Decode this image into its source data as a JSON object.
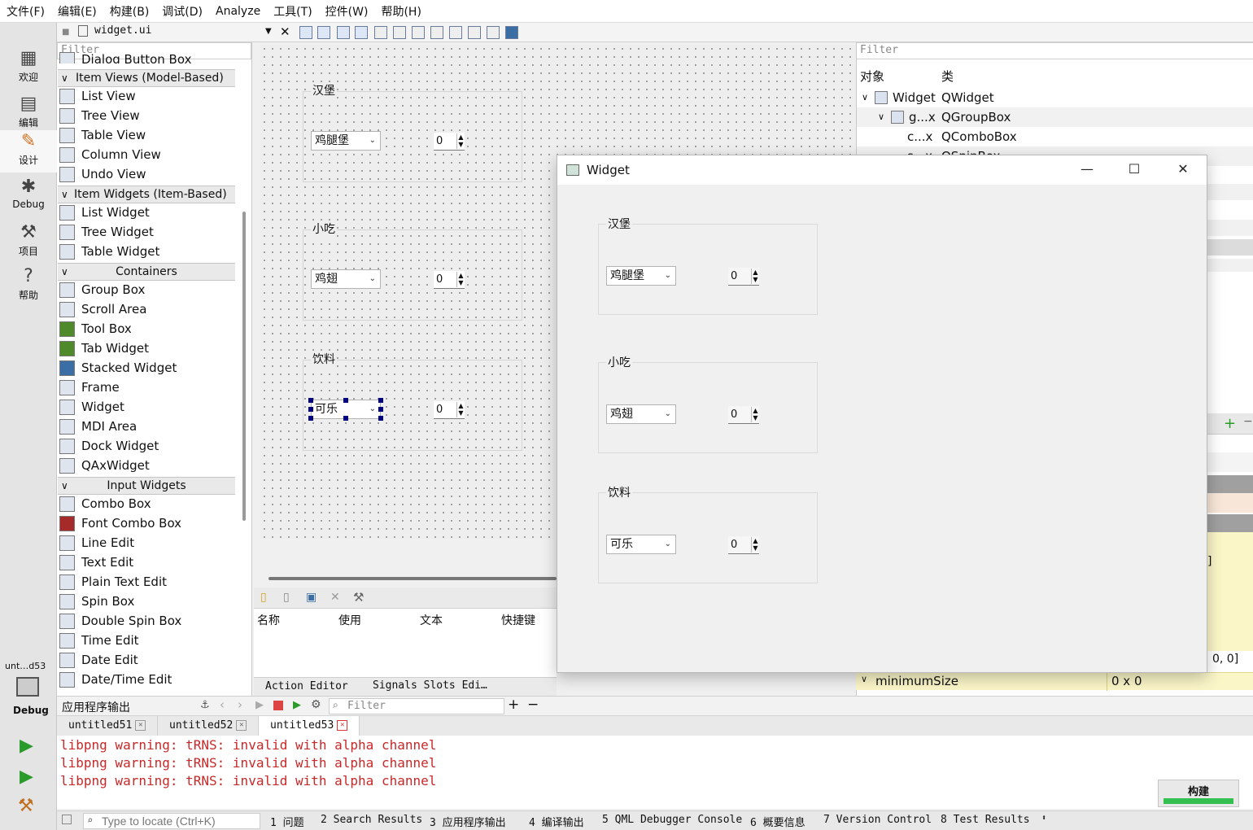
{
  "menu": [
    "文件(F)",
    "编辑(E)",
    "构建(B)",
    "调试(D)",
    "Analyze",
    "工具(T)",
    "控件(W)",
    "帮助(H)"
  ],
  "modes": [
    {
      "label": "欢迎",
      "icon": "grid-icon"
    },
    {
      "label": "编辑",
      "icon": "document-icon"
    },
    {
      "label": "设计",
      "icon": "pencil-icon"
    },
    {
      "label": "Debug",
      "icon": "bug-icon"
    },
    {
      "label": "项目",
      "icon": "wrench-icon"
    },
    {
      "label": "帮助",
      "icon": "help-icon"
    }
  ],
  "kit": {
    "label": "unt…d53",
    "mode": "Debug"
  },
  "editor": {
    "file": "widget.ui"
  },
  "widgetbox": {
    "filter": "Filter",
    "cut_item": "Dialog Button Box",
    "categories": [
      {
        "title": "Item Views (Model-Based)",
        "items": [
          "List View",
          "Tree View",
          "Table View",
          "Column View",
          "Undo View"
        ]
      },
      {
        "title": "Item Widgets (Item-Based)",
        "items": [
          "List Widget",
          "Tree Widget",
          "Table Widget"
        ]
      },
      {
        "title": "Containers",
        "items": [
          "Group Box",
          "Scroll Area",
          "Tool Box",
          "Tab Widget",
          "Stacked Widget",
          "Frame",
          "Widget",
          "MDI Area",
          "Dock Widget",
          "QAxWidget"
        ]
      },
      {
        "title": "Input Widgets",
        "items": [
          "Combo Box",
          "Font Combo Box",
          "Line Edit",
          "Text Edit",
          "Plain Text Edit",
          "Spin Box",
          "Double Spin Box",
          "Time Edit",
          "Date Edit",
          "Date/Time Edit"
        ]
      }
    ]
  },
  "form": {
    "groups": [
      {
        "title": "汉堡",
        "combo": "鸡腿堡",
        "spin": "0"
      },
      {
        "title": "小吃",
        "combo": "鸡翅",
        "spin": "0"
      },
      {
        "title": "饮料",
        "combo": "可乐",
        "spin": "0"
      }
    ]
  },
  "action_editor": {
    "columns": [
      "名称",
      "使用",
      "文本",
      "快捷键"
    ],
    "tabs": [
      "Action Editor",
      "Signals Slots Edi…"
    ]
  },
  "object_inspector": {
    "filter": "Filter",
    "headers": [
      "对象",
      "类"
    ],
    "rows": [
      {
        "object": "Widget",
        "class": "QWidget"
      },
      {
        "object": "g...x",
        "class": "QGroupBox"
      },
      {
        "object": "c...x",
        "class": "QComboBox"
      },
      {
        "object": "s...x",
        "class": "QSpinBox"
      }
    ]
  },
  "property_editor": {
    "min_size_label": "minimumSize",
    "min_size_value": "0 x 0",
    "partial_value": "0, 0]",
    "partial_bracket": "]"
  },
  "preview_window": {
    "title": "Widget"
  },
  "output": {
    "title": "应用程序输出",
    "filter": "Filter",
    "tabs": [
      "untitled51",
      "untitled52",
      "untitled53"
    ],
    "lines": [
      "libpng warning: tRNS: invalid with alpha channel",
      "libpng warning: tRNS: invalid with alpha channel",
      "libpng warning: tRNS: invalid with alpha channel"
    ]
  },
  "build_label": "构建",
  "status": {
    "locate": "Type to locate (Ctrl+K)",
    "items": [
      "1 问题",
      "2 Search Results",
      "3 应用程序输出",
      "4 编译输出",
      "5 QML Debugger Console",
      "6 概要信息",
      "7 Version Control",
      "8 Test Results"
    ]
  }
}
